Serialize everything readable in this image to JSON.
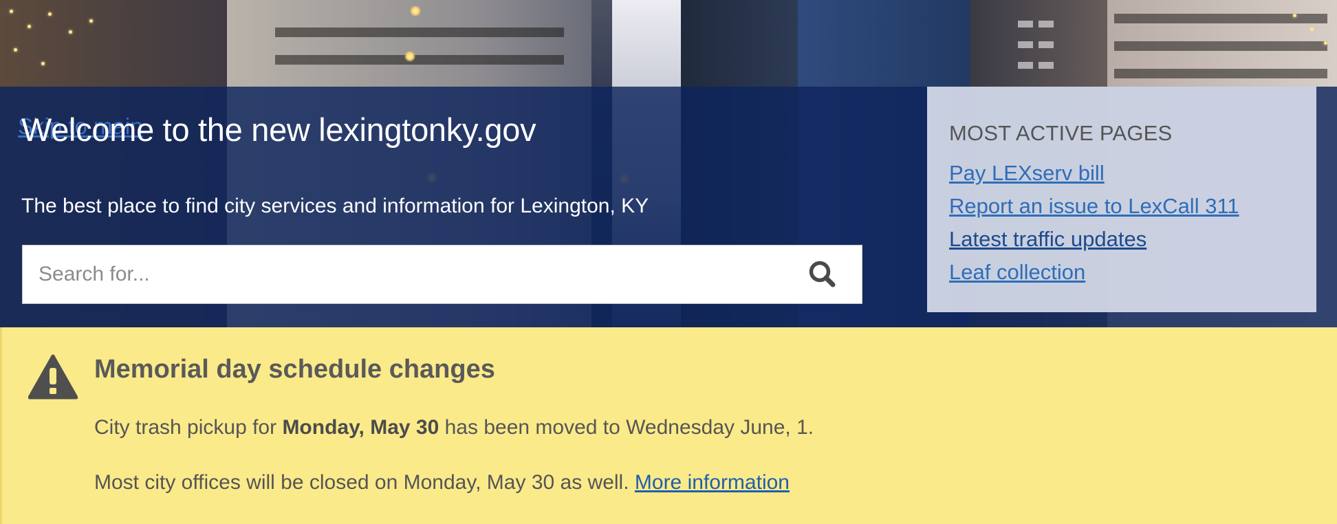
{
  "skip_link": "Skip to main",
  "hero": {
    "title": "Welcome to the new lexingtonky.gov",
    "tagline": "The best place to find city services and information for Lexington, KY",
    "search": {
      "placeholder": "Search for...",
      "icon": "search-icon"
    }
  },
  "most_active": {
    "heading": "MOST ACTIVE PAGES",
    "links": [
      {
        "label": "Pay LEXserv bill"
      },
      {
        "label": "Report an issue to LexCall 311"
      },
      {
        "label": "Latest traffic updates"
      },
      {
        "label": "Leaf collection"
      }
    ]
  },
  "alert": {
    "icon": "warning-icon",
    "title": "Memorial day schedule changes",
    "line1_prefix": "City trash pickup for ",
    "line1_bold": "Monday, May 30",
    "line1_suffix": " has been moved to Wednesday June, 1.",
    "line2_text": "Most city offices will be closed on Monday, May 30 as well. ",
    "line2_link": "More information"
  },
  "colors": {
    "hero_overlay": "#0d245d",
    "panel_bg": "#d6dbe9",
    "link": "#2f6db8",
    "alert_bg": "#fbea8a",
    "alert_text": "#555555"
  }
}
